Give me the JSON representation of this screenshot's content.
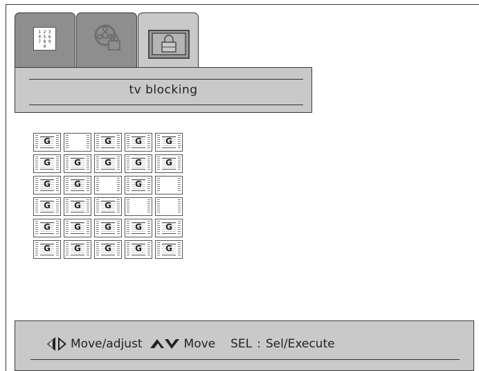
{
  "tabs": [
    {
      "name": "channel-numbers",
      "icon": "keypad-icon",
      "keypad": [
        "1 2 3",
        "4 5 6",
        "7 8 9",
        "0"
      ],
      "active": false
    },
    {
      "name": "movie",
      "icon": "film-reel-lock-icon",
      "active": false
    },
    {
      "name": "tv",
      "icon": "tv-lock-icon",
      "active": true
    }
  ],
  "title": "tv blocking",
  "rating_grid": {
    "rows": [
      [
        "G",
        "",
        "G",
        "G",
        "G"
      ],
      [
        "G",
        "G",
        "G",
        "G",
        "G"
      ],
      [
        "G",
        "G",
        "",
        "G",
        ""
      ],
      [
        "G",
        "G",
        "G",
        "",
        ""
      ],
      [
        "G",
        "G",
        "G",
        "G",
        "G"
      ],
      [
        "G",
        "G",
        "G",
        "G",
        "G"
      ]
    ]
  },
  "help": {
    "move_adjust": "Move/adjust",
    "move": "Move",
    "sel_key": "SEL",
    "separator": ":",
    "sel_action": "Sel/Execute"
  },
  "colors": {
    "panel": "#c9c9c9",
    "tab_inactive": "#8e8e8e",
    "border": "#3a3a3a"
  }
}
